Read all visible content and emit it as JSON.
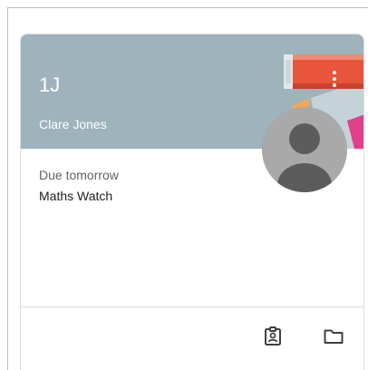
{
  "class_card": {
    "class_name": "1J",
    "teacher_name": "Clare Jones",
    "due_label": "Due tomorrow",
    "assignment_title": "Maths Watch",
    "header_color": "#9eb3bb",
    "accent_color": "#e8553a",
    "icons": {
      "menu": "more-vert-icon",
      "avatar": "person-avatar-icon",
      "work": "assignment-ind-icon",
      "folder": "folder-icon"
    }
  }
}
